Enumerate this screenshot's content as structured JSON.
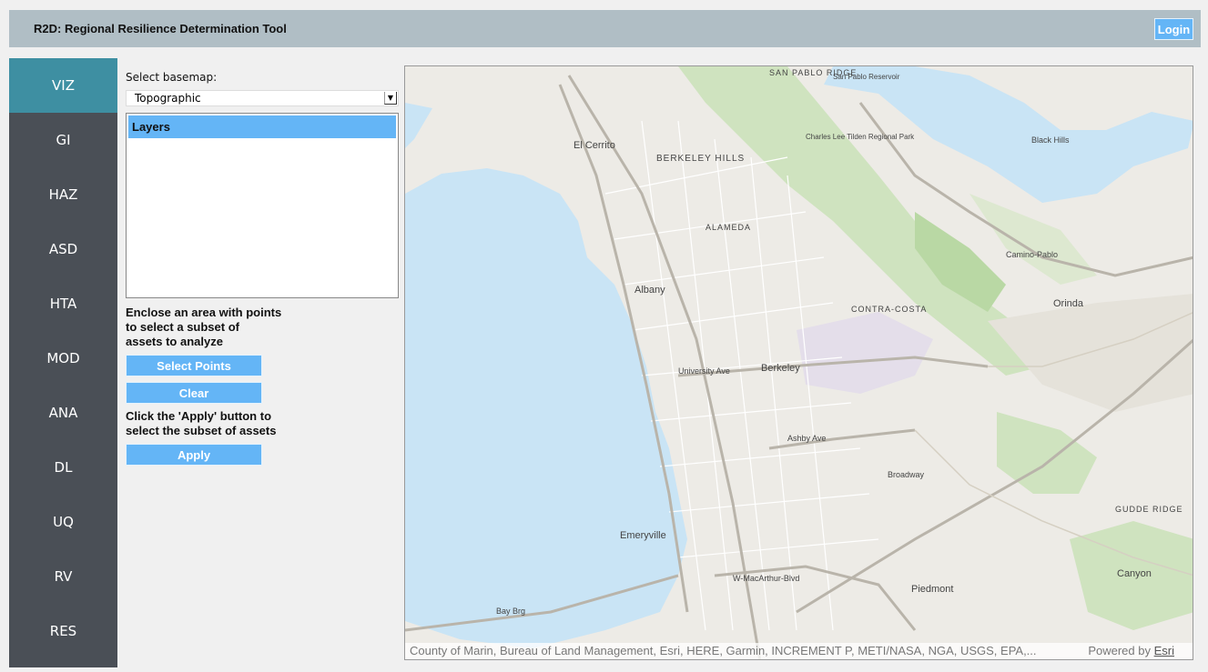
{
  "app": {
    "title": "R2D: Regional Resilience Determination Tool",
    "login_label": "Login"
  },
  "sidebar": {
    "items": [
      {
        "label": "VIZ",
        "active": true
      },
      {
        "label": "GI"
      },
      {
        "label": "HAZ"
      },
      {
        "label": "ASD"
      },
      {
        "label": "HTA"
      },
      {
        "label": "MOD"
      },
      {
        "label": "ANA"
      },
      {
        "label": "DL"
      },
      {
        "label": "UQ"
      },
      {
        "label": "RV"
      },
      {
        "label": "RES"
      }
    ]
  },
  "controls": {
    "basemap_label": "Select basemap:",
    "basemap_value": "Topographic",
    "layers_header": "Layers",
    "enclose_text_1": "Enclose an area with points",
    "enclose_text_2": "to select a subset of",
    "enclose_text_3": "assets to analyze",
    "select_points_label": "Select Points",
    "clear_label": "Clear",
    "apply_text_1": "Click the 'Apply' button to",
    "apply_text_2": "select the subset of assets",
    "apply_label": "Apply"
  },
  "map": {
    "labels": {
      "el_cerrito": "El Cerrito",
      "berkeley_hills": "BERKELEY HILLS",
      "albany": "Albany",
      "berkeley": "Berkeley",
      "emeryville": "Emeryville",
      "orinda": "Orinda",
      "piedmont": "Piedmont",
      "canyon": "Canyon",
      "alameda": "ALAMEDA",
      "contra_costa": "CONTRA-COSTA",
      "tilden": "Charles Lee Tilden Regional Park",
      "san_pablo_ridge": "SAN PABLO RIDGE",
      "san_pablo_reservoir": "San Pablo Reservoir",
      "university": "University Ave",
      "ashby": "Ashby Ave",
      "broadway": "Broadway",
      "macarthur": "W-MacArthur-Blvd",
      "bay_brg": "Bay Brg",
      "camino_pablo": "Camino-Pablo",
      "black_hills": "Black Hills",
      "gudde_ridge": "GUDDE RIDGE"
    },
    "attribution": "County of Marin, Bureau of Land Management, Esri, HERE, Garmin, INCREMENT P, METI/NASA, NGA, USGS, EPA,...",
    "powered_by": "Powered by",
    "esri_link": "Esri"
  }
}
